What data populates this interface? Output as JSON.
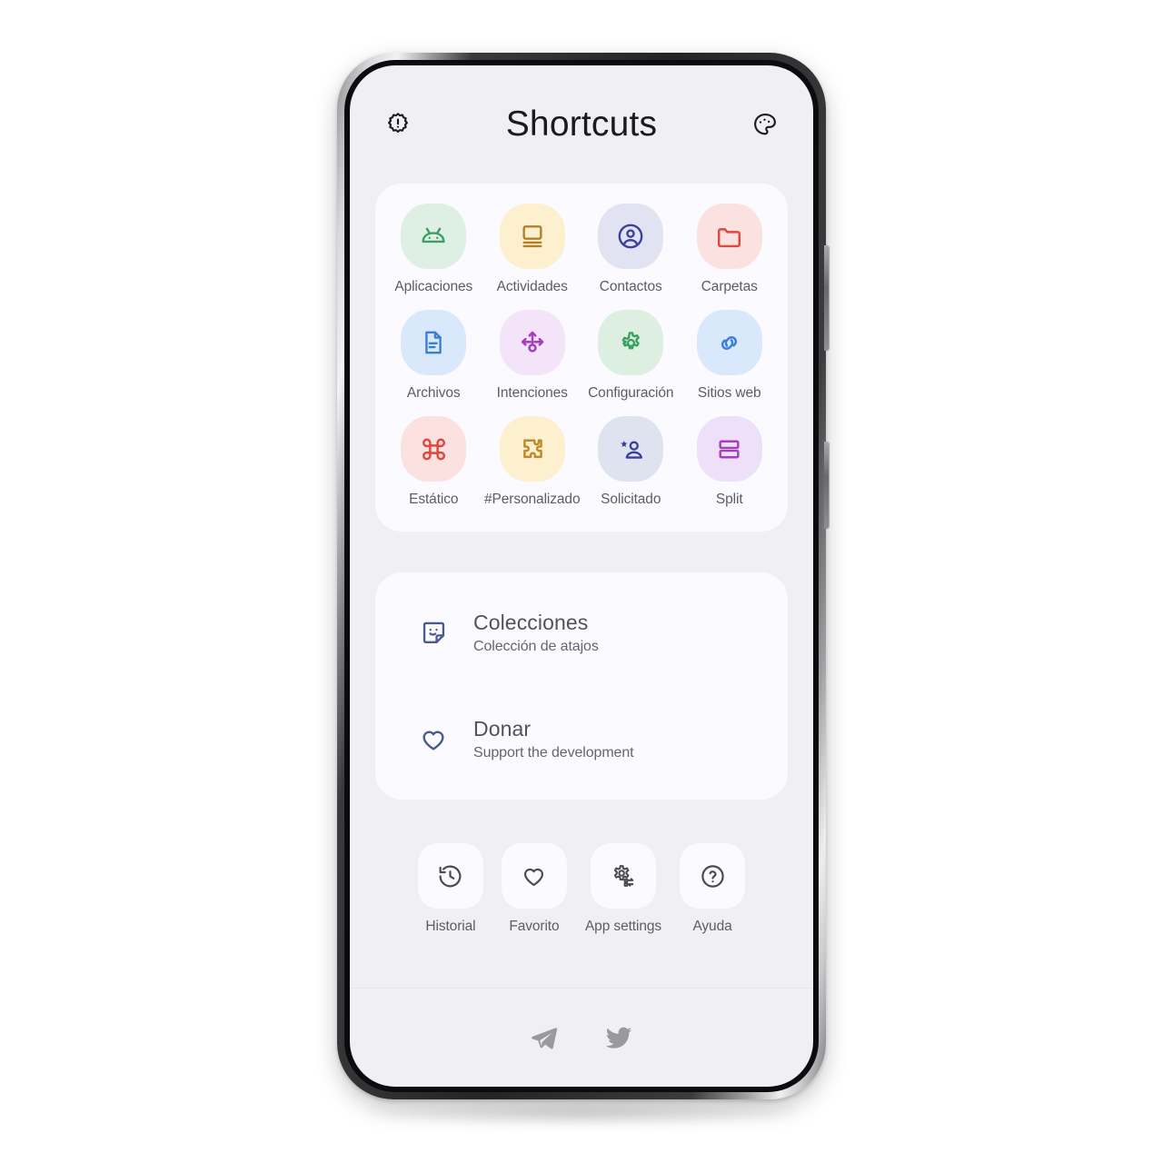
{
  "app": {
    "title": "Shortcuts",
    "screen_bg": "#f0eff4",
    "card_bg": "#fafaff"
  },
  "app_bar": {
    "left_action": {
      "name": "badge-alert-icon",
      "label": "Badge alert"
    },
    "right_action": {
      "name": "palette-icon",
      "label": "Palette"
    }
  },
  "shortcuts": {
    "items": [
      {
        "label": "Aplicaciones",
        "icon": "android-icon",
        "fg": "#3e9e63",
        "bg": "#ddf0e3"
      },
      {
        "label": "Actividades",
        "icon": "monitor-icon",
        "fg": "#b0802b",
        "bg": "#fcf0cf"
      },
      {
        "label": "Contactos",
        "icon": "account-circle-icon",
        "fg": "#3f3f9e",
        "bg": "#e2e3f2"
      },
      {
        "label": "Carpetas",
        "icon": "folder-icon",
        "fg": "#e0473f",
        "bg": "#fbe2e0"
      },
      {
        "label": "Archivos",
        "icon": "document-icon",
        "fg": "#3b7fd4",
        "bg": "#d9e8fb"
      },
      {
        "label": "Intenciones",
        "icon": "routes-arrows-icon",
        "fg": "#a33fc0",
        "bg": "#f4e4f9"
      },
      {
        "label": "Configuración",
        "icon": "gear-icon",
        "fg": "#35a35c",
        "bg": "#ddefe0"
      },
      {
        "label": "Sitios web",
        "icon": "link-icon",
        "fg": "#3c7fd8",
        "bg": "#d9e8fb"
      },
      {
        "label": "Estático",
        "icon": "command-icon",
        "fg": "#e0473f",
        "bg": "#fbe2e0"
      },
      {
        "label": "#Personalizado",
        "icon": "puzzle-icon",
        "fg": "#c08a2a",
        "bg": "#fcf0cf"
      },
      {
        "label": "Solicitado",
        "icon": "person-star-icon",
        "fg": "#3a3f9e",
        "bg": "#dfe3ef"
      },
      {
        "label": "Split",
        "icon": "split-rows-icon",
        "fg": "#a33fc0",
        "bg": "#eee0f8"
      }
    ]
  },
  "list": {
    "items": [
      {
        "title": "Colecciones",
        "subtitle": "Colección de atajos",
        "icon": "sticker-smile-icon",
        "fg": "#4a5a8c"
      },
      {
        "title": "Donar",
        "subtitle": "Support the development",
        "icon": "heart-icon",
        "fg": "#4a5a8c"
      }
    ]
  },
  "quick_actions": {
    "items": [
      {
        "label": "Historial",
        "icon": "history-icon"
      },
      {
        "label": "Favorito",
        "icon": "heart-icon"
      },
      {
        "label": "App settings",
        "icon": "gear-sliders-icon"
      },
      {
        "label": "Ayuda",
        "icon": "help-circle-icon"
      }
    ]
  },
  "footer": {
    "items": [
      {
        "name": "telegram-icon",
        "label": "Telegram"
      },
      {
        "name": "twitter-icon",
        "label": "Twitter"
      }
    ]
  }
}
